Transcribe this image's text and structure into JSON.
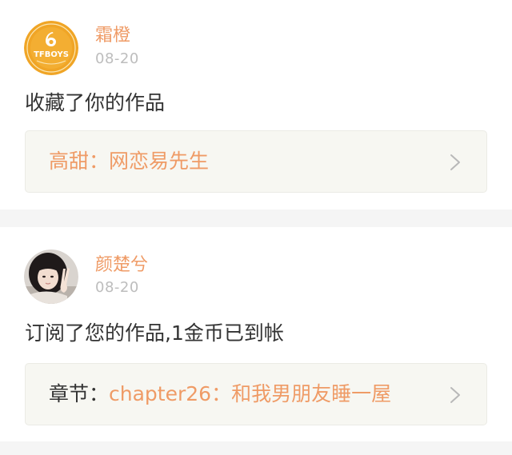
{
  "colors": {
    "accent": "#ef9b66",
    "text_primary": "#333333",
    "text_secondary": "#bdbdbd",
    "link_background": "#f7f7f2",
    "separator": "#f5f5f5"
  },
  "notifications": [
    {
      "username": "霜橙",
      "timestamp": "08-20",
      "avatar": {
        "icon": "tfboys-logo-avatar",
        "text": "TFBOYS"
      },
      "message": "收藏了你的作品",
      "work_link": {
        "title": "高甜：网恋易先生",
        "icon": "chevron-right-icon"
      }
    },
    {
      "username": "颜楚兮",
      "timestamp": "08-20",
      "avatar": {
        "icon": "user-photo-avatar"
      },
      "message": "订阅了您的作品,1金币已到帐",
      "work_link": {
        "prefix": "章节：",
        "title": "chapter26：和我男朋友睡一屋",
        "icon": "chevron-right-icon"
      }
    }
  ]
}
